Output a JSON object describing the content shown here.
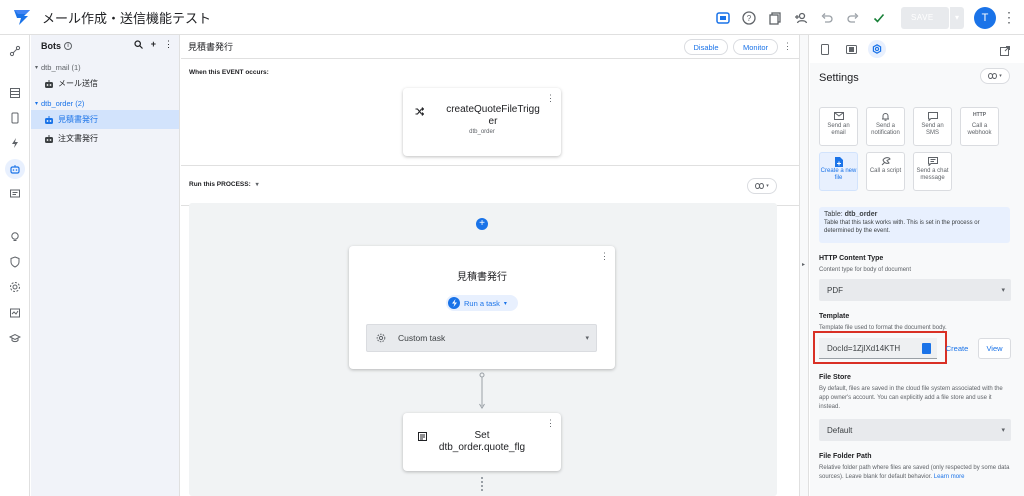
{
  "app": {
    "title": "メール作成・送信機能テスト",
    "save_label": "SAVE",
    "avatar_initial": "T"
  },
  "bots": {
    "heading": "Bots",
    "groups": [
      {
        "label": "dtb_mail (1)",
        "items": [
          "メール送信"
        ]
      },
      {
        "label": "dtb_order (2)",
        "items": [
          "見積書発行",
          "注文書発行"
        ]
      }
    ]
  },
  "main": {
    "title": "見積書発行",
    "disable_label": "Disable",
    "monitor_label": "Monitor",
    "event_heading": "When this EVENT occurs:",
    "event_card": {
      "title_line1": "createQuoteFileTrigg",
      "title_line2": "er",
      "subtitle": "dtb_order"
    },
    "process_heading": "Run this PROCESS:",
    "step_card": {
      "title": "見積書発行",
      "run_label": "Run a task",
      "task_label": "Custom task"
    },
    "set_card": {
      "line1": "Set",
      "line2": "dtb_order.quote_flg"
    }
  },
  "settings": {
    "title": "Settings",
    "tiles": [
      {
        "label": "Send an email",
        "icon": "envelope-icon"
      },
      {
        "label": "Send a notification",
        "icon": "bell-icon"
      },
      {
        "label": "Send an SMS",
        "icon": "sms-icon"
      },
      {
        "label": "Call a webhook",
        "icon": "http-icon",
        "icon_text": "HTTP"
      },
      {
        "label": "Create a new file",
        "icon": "file-plus-icon",
        "active": true
      },
      {
        "label": "Call a script",
        "icon": "script-icon"
      },
      {
        "label": "Send a chat message",
        "icon": "chat-icon"
      }
    ],
    "table_label": "Table:",
    "table_name": "dtb_order",
    "table_desc": "Table that this task works with. This is set in the process or determined by the event.",
    "http_content_type": {
      "label": "HTTP Content Type",
      "desc": "Content type for body of document",
      "value": "PDF"
    },
    "template": {
      "label": "Template",
      "desc": "Template file used to format the document body.",
      "value": "DocId=1ZjlXd14KTH",
      "create_label": "Create",
      "view_label": "View"
    },
    "file_store": {
      "label": "File Store",
      "desc": "By default, files are saved in the cloud file system associated with the app owner's account. You can explicitly add a file store and use it instead.",
      "value": "Default"
    },
    "file_folder_path": {
      "label": "File Folder Path",
      "desc": "Relative folder path where files are saved (only respected by some data sources). Leave blank for default behavior.",
      "learn_label": "Learn",
      "more_label": "more"
    }
  },
  "colors": {
    "accent": "#1a73e8",
    "highlight": "#d93025",
    "selected_bg": "#d2e3fc"
  }
}
